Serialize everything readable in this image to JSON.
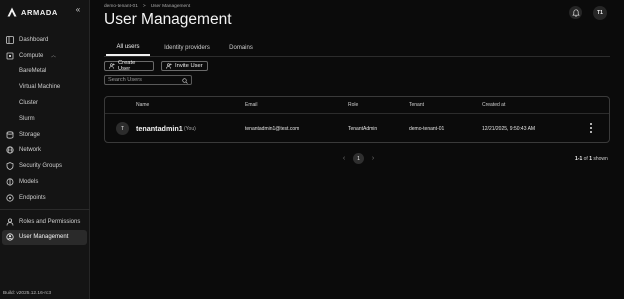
{
  "sidebar": {
    "brand": "ARMADA",
    "items": [
      {
        "label": "Dashboard",
        "icon": "dashboard-icon"
      },
      {
        "label": "Compute",
        "icon": "compute-icon",
        "expanded": true
      },
      {
        "label": "BareMetal"
      },
      {
        "label": "Virtual Machine"
      },
      {
        "label": "Cluster"
      },
      {
        "label": "Slurm"
      },
      {
        "label": "Storage",
        "icon": "storage-icon"
      },
      {
        "label": "Network",
        "icon": "network-icon"
      },
      {
        "label": "Security Groups",
        "icon": "shield-icon"
      },
      {
        "label": "Models",
        "icon": "models-icon"
      },
      {
        "label": "Endpoints",
        "icon": "endpoints-icon"
      },
      {
        "label": "Roles and Permissions",
        "icon": "roles-icon"
      },
      {
        "label": "User Management",
        "icon": "user-management-icon",
        "active": true
      }
    ],
    "build": "Build: v2025.12.16-rc3"
  },
  "header": {
    "breadcrumb": [
      "demo-tenant-01",
      ">",
      "User Management"
    ],
    "title": "User Management",
    "avatar_initials": "T1"
  },
  "tabs": [
    {
      "label": "All users",
      "active": true
    },
    {
      "label": "Identity providers"
    },
    {
      "label": "Domains"
    }
  ],
  "actions": {
    "create_label": "Create User",
    "invite_label": "Invite User",
    "search_placeholder": "Search Users"
  },
  "table": {
    "columns": [
      "Name",
      "Email",
      "Role",
      "Tenant",
      "Created at"
    ],
    "rows": [
      {
        "avatar": "T",
        "name": "tenantadmin1",
        "you": "(You)",
        "email": "tenantadmin1@test.com",
        "role": "TenantAdmin",
        "tenant": "demo-tenant-01",
        "created": "12/21/2025, 9:50:43 AM"
      }
    ]
  },
  "pagination": {
    "prev": "‹",
    "page": "1",
    "next": "›",
    "info_range": "1-1",
    "info_of": "of",
    "info_total": "1",
    "info_suffix": "shown"
  }
}
